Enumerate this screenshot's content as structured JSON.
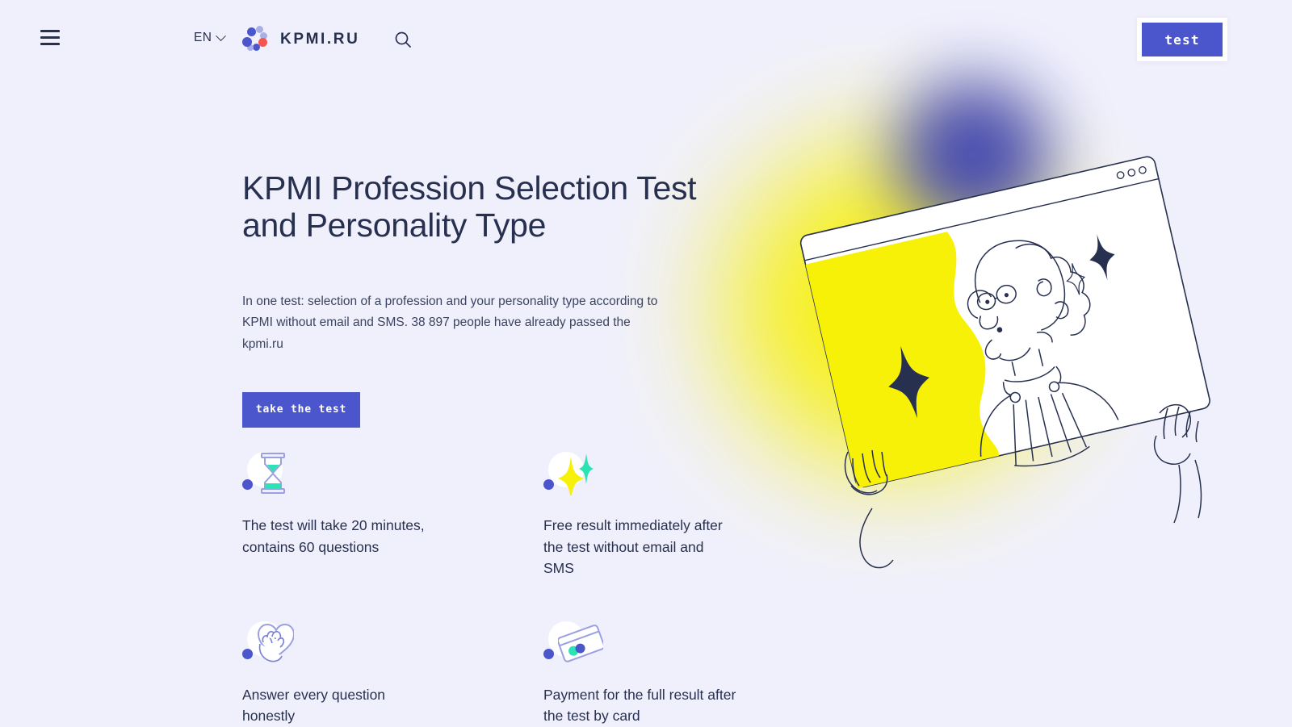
{
  "theme": {
    "background": "#F0F0FD",
    "primary_blue": "#4B55CC",
    "text_dark": "#27304F",
    "accent_red": "#F4564E",
    "accent_yellow": "#F7F007",
    "accent_teal": "#2BE3B4",
    "lilac": "#A9AEE6"
  },
  "header": {
    "menu_icon": "hamburger-menu-icon",
    "language": {
      "label": "EN",
      "chevron_icon": "chevron-down-icon"
    },
    "brand": {
      "logo_icon": "kpmi-dots-logo-icon",
      "name": "KPMI.RU"
    },
    "search_icon": "search-icon",
    "test_button": {
      "label": "test"
    }
  },
  "hero": {
    "title": "KPMI Profession Selection Test and Personality Type",
    "subtitle": "In one test: selection of a profession and your personality type according to KPMI without email and SMS. 38 897 people have already passed the kpmi.ru",
    "cta_label": "take the test",
    "illustration": {
      "name": "person-holding-browser-window-illustration",
      "glow_yellow": "#F7F007",
      "glow_blue": "#3B3FB0"
    }
  },
  "features": [
    {
      "icon": "hourglass-icon",
      "text": "The test will take 20 minutes, contains 60 questions"
    },
    {
      "icon": "sparkles-icon",
      "text": "Free result immediately after the test without email and SMS"
    },
    {
      "icon": "hand-heart-icon",
      "text": "Answer every question honestly"
    },
    {
      "icon": "credit-card-icon",
      "text": "Payment for the full result after the test by card"
    }
  ]
}
